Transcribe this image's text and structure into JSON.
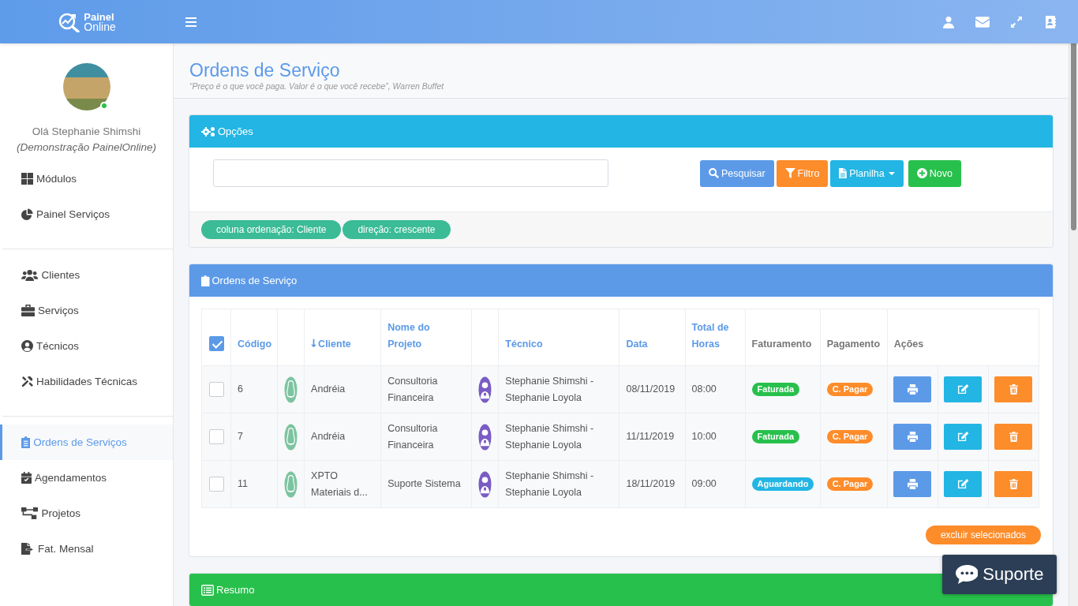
{
  "brand": {
    "line1": "Painel",
    "line2": "Online"
  },
  "topbar": {
    "icons": [
      {
        "kind": "user"
      },
      {
        "kind": "mail"
      },
      {
        "kind": "expand"
      },
      {
        "kind": "contacts"
      }
    ]
  },
  "user": {
    "greeting": "Olá Stephanie Shimshi",
    "role": "(Demonstração PainelOnline)",
    "online": true
  },
  "sidebar": {
    "groups": [
      [
        {
          "kind": "grid",
          "label": "Módulos",
          "selected": false
        },
        {
          "kind": "pie",
          "label": "Painel Serviços",
          "selected": false
        }
      ],
      [
        {
          "kind": "users",
          "label": "Clientes",
          "selected": false
        },
        {
          "kind": "briefcase",
          "label": "Serviços",
          "selected": false
        },
        {
          "kind": "user-circle",
          "label": "Técnicos",
          "selected": false
        },
        {
          "kind": "tools",
          "label": "Habilidades Técnicas",
          "selected": false
        }
      ],
      [
        {
          "kind": "clipboard",
          "label": "Ordens de Serviços",
          "selected": true
        },
        {
          "kind": "calendar",
          "label": "Agendamentos",
          "selected": false
        },
        {
          "kind": "sitemap",
          "label": "Projetos",
          "selected": false
        },
        {
          "kind": "file-export",
          "label": "Fat. Mensal",
          "selected": false
        }
      ]
    ]
  },
  "page": {
    "title": "Ordens de Serviço",
    "quote": "“Preço é o que você paga. Valor é o que você recebe”, Warren Buffet"
  },
  "options": {
    "title": "Opções",
    "buttons": [
      {
        "kind": "search",
        "label": "Pesquisar"
      },
      {
        "kind": "filter",
        "label": "Filtro"
      },
      {
        "kind": "sheet",
        "label": "Planilha"
      },
      {
        "kind": "new",
        "label": "Novo"
      }
    ],
    "tags": [
      "coluna ordenação: Cliente",
      "direção: crescente"
    ]
  },
  "orders": {
    "title": "Ordens de Serviço",
    "columns": [
      {
        "kind": "check",
        "checked": true
      },
      {
        "kind": "text",
        "label": "Código",
        "sortable": true,
        "sorted": false
      },
      {
        "kind": "avatar"
      },
      {
        "kind": "text",
        "label": "Cliente",
        "sortable": true,
        "sorted": true
      },
      {
        "kind": "text",
        "label": "Nome do Projeto",
        "sortable": true,
        "sorted": false
      },
      {
        "kind": "avatar"
      },
      {
        "kind": "text",
        "label": "Técnico",
        "sortable": true,
        "sorted": false
      },
      {
        "kind": "text",
        "label": "Data",
        "sortable": true,
        "sorted": false
      },
      {
        "kind": "text",
        "label": "Total de Horas",
        "sortable": true,
        "sorted": false
      },
      {
        "kind": "text",
        "label": "Faturamento",
        "sortable": false,
        "sorted": false
      },
      {
        "kind": "text",
        "label": "Pagamento",
        "sortable": false,
        "sorted": false
      },
      {
        "kind": "actions",
        "label": "Ações"
      }
    ],
    "rows": [
      {
        "checked": false,
        "code": "6",
        "client": "Andréia",
        "project": "Consultoria Financeira",
        "technician": "Stephanie Shimshi - Stephanie Loyola",
        "date": "08/11/2019",
        "hours": "08:00",
        "billing": {
          "label": "Faturada",
          "color": "#28c04c"
        },
        "payment": {
          "label": "C. Pagar",
          "color": "#fd8c2a"
        }
      },
      {
        "checked": false,
        "code": "7",
        "client": "Andréia",
        "project": "Consultoria Financeira",
        "technician": "Stephanie Shimshi - Stephanie Loyola",
        "date": "11/11/2019",
        "hours": "10:00",
        "billing": {
          "label": "Faturada",
          "color": "#28c04c"
        },
        "payment": {
          "label": "C. Pagar",
          "color": "#fd8c2a"
        }
      },
      {
        "checked": false,
        "code": "11",
        "client": "XPTO Materiais d...",
        "project": "Suporte Sistema",
        "technician": "Stephanie Shimshi - Stephanie Loyola",
        "date": "18/11/2019",
        "hours": "09:00",
        "billing": {
          "label": "Aguardando",
          "color": "#23b5e3"
        },
        "payment": {
          "label": "C. Pagar",
          "color": "#fd8c2a"
        }
      }
    ],
    "delete_selected": "excluir selecionados"
  },
  "summary": {
    "title": "Resumo"
  },
  "support": {
    "label": "Suporte"
  }
}
